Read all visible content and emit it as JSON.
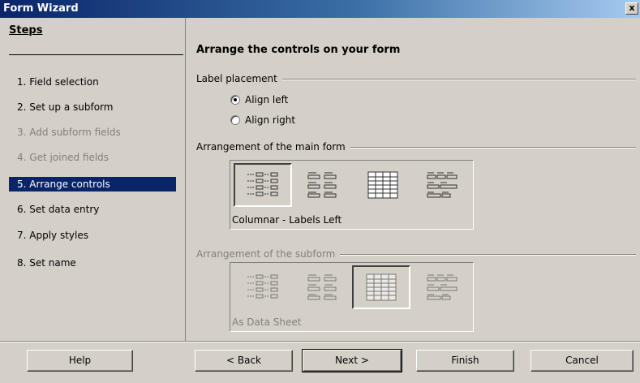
{
  "window": {
    "title": "Form Wizard",
    "close_glyph": "x"
  },
  "sidebar": {
    "heading": "Steps",
    "items": [
      {
        "label": "1.  Field selection",
        "state": "enabled"
      },
      {
        "label": "2.  Set up a subform",
        "state": "enabled"
      },
      {
        "label": "3.  Add subform fields",
        "state": "disabled"
      },
      {
        "label": "4.  Get joined fields",
        "state": "disabled"
      },
      {
        "label": "5.  Arrange controls",
        "state": "active"
      },
      {
        "label": "6.  Set data entry",
        "state": "enabled"
      },
      {
        "label": "7.  Apply styles",
        "state": "enabled"
      },
      {
        "label": "8.  Set name",
        "state": "enabled"
      }
    ]
  },
  "main": {
    "heading": "Arrange the controls on your form",
    "label_placement": {
      "title": "Label placement",
      "options": [
        {
          "label": "Align left",
          "checked": true
        },
        {
          "label": "Align right",
          "checked": false
        }
      ]
    },
    "main_form": {
      "title": "Arrangement of the main form",
      "selected_index": 0,
      "caption": "Columnar - Labels Left",
      "options": [
        "columnar-labels-left-icon",
        "columnar-labels-top-icon",
        "data-sheet-icon",
        "in-blocks-labels-above-icon"
      ]
    },
    "subform": {
      "title": "Arrangement of the subform",
      "selected_index": 2,
      "caption": "As Data Sheet",
      "options": [
        "columnar-labels-left-icon",
        "columnar-labels-top-icon",
        "data-sheet-icon",
        "in-blocks-labels-above-icon"
      ]
    }
  },
  "buttons": {
    "help": "Help",
    "back": "< Back",
    "next": "Next >",
    "finish": "Finish",
    "cancel": "Cancel"
  }
}
